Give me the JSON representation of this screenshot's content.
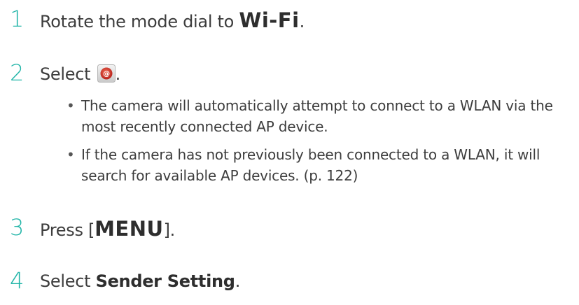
{
  "steps": [
    {
      "number": "1",
      "text_before": "Rotate the mode dial to ",
      "emphasis": "Wi-Fi",
      "text_after": "."
    },
    {
      "number": "2",
      "text_before": "Select ",
      "icon": "email-icon",
      "text_after": ".",
      "bullets": [
        "The camera will automatically attempt to connect to a WLAN via the most recently connected AP device.",
        "If the camera has not previously been connected to a WLAN, it will search for available AP devices. (p. 122)"
      ]
    },
    {
      "number": "3",
      "text_before": "Press [",
      "emphasis": "MENU",
      "text_after": "]."
    },
    {
      "number": "4",
      "text_before": "Select ",
      "emphasis": "Sender Setting",
      "text_after": "."
    }
  ],
  "colors": {
    "step_number": "#22b5a8",
    "text": "#3d3d3d",
    "icon_red": "#d0312d"
  }
}
